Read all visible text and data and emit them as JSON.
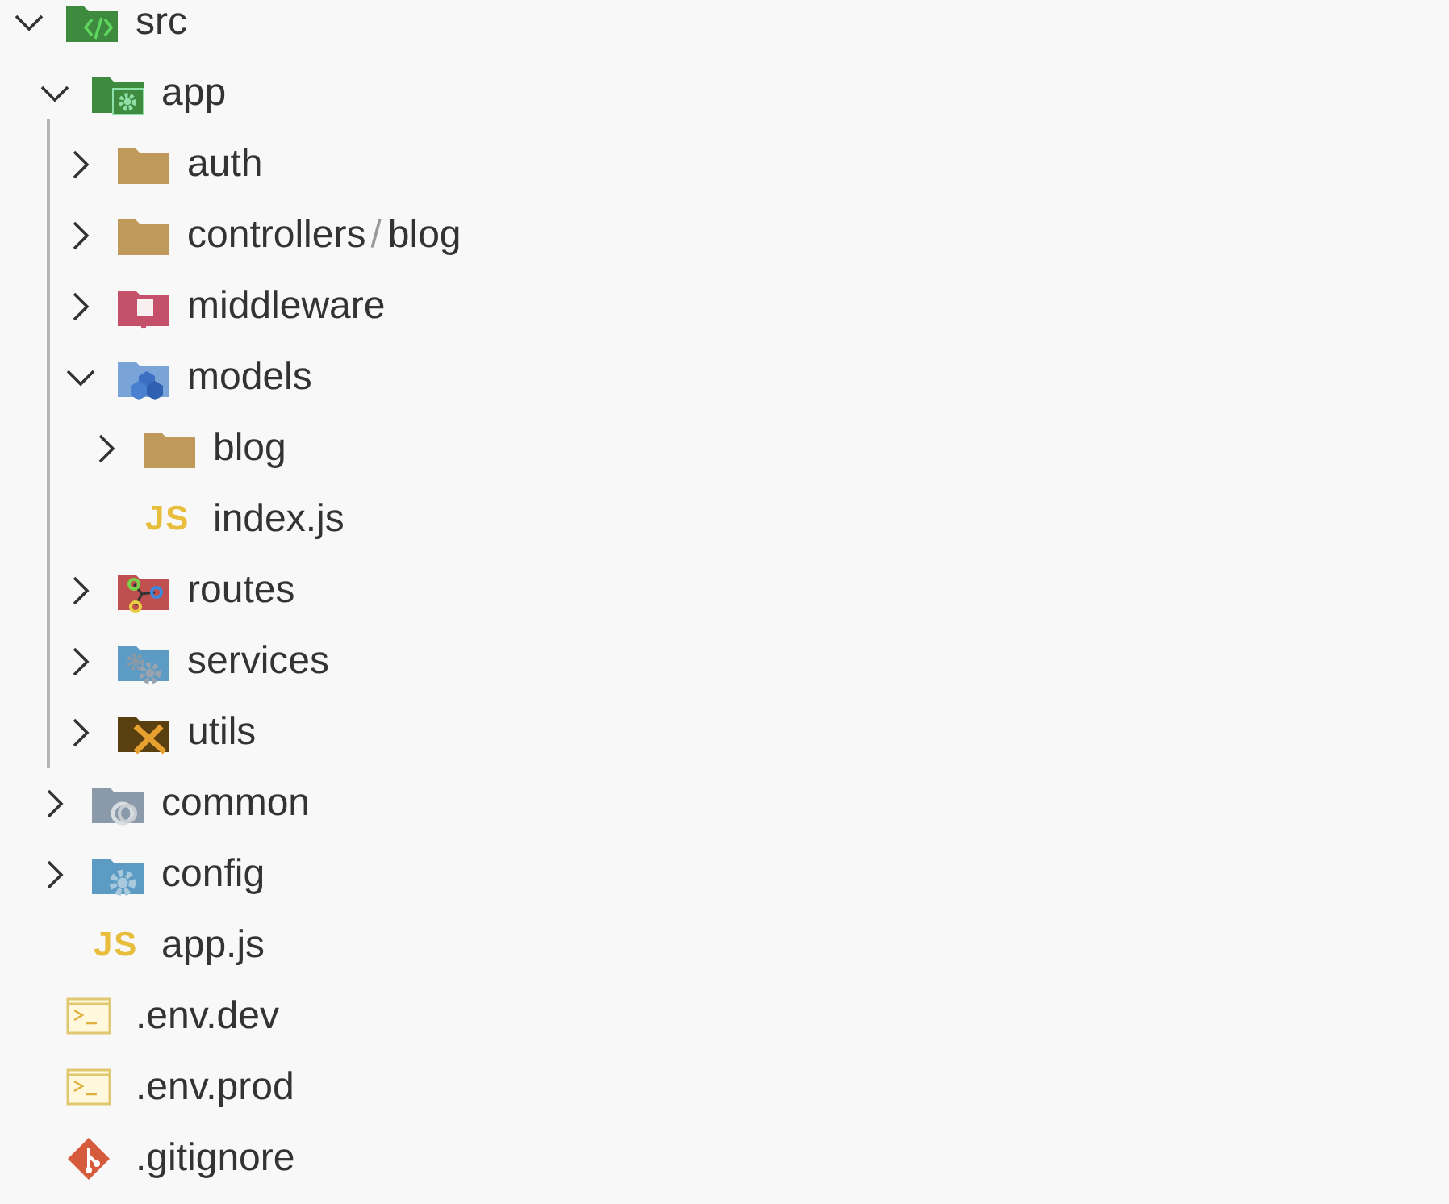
{
  "tree": [
    {
      "label": "src",
      "kind": "src",
      "expanded": true,
      "children": [
        {
          "label": "app",
          "kind": "app",
          "expanded": true,
          "guide": true,
          "children": [
            {
              "label": "auth",
              "kind": "folder",
              "expanded": false
            },
            {
              "label": "controllers",
              "separator": "/",
              "compact_label": "blog",
              "kind": "folder",
              "expanded": false
            },
            {
              "label": "middleware",
              "kind": "middleware",
              "expanded": false
            },
            {
              "label": "models",
              "kind": "models",
              "expanded": true,
              "children": [
                {
                  "label": "blog",
                  "kind": "folder",
                  "expanded": false
                },
                {
                  "label": "index.js",
                  "kind": "js",
                  "badge": "JS"
                }
              ]
            },
            {
              "label": "routes",
              "kind": "routes",
              "expanded": false
            },
            {
              "label": "services",
              "kind": "services",
              "expanded": false
            },
            {
              "label": "utils",
              "kind": "utils",
              "expanded": false
            }
          ]
        },
        {
          "label": "common",
          "kind": "common",
          "expanded": false
        },
        {
          "label": "config",
          "kind": "config",
          "expanded": false
        },
        {
          "label": "app.js",
          "kind": "js",
          "badge": "JS"
        }
      ]
    },
    {
      "label": ".env.dev",
      "kind": "terminal"
    },
    {
      "label": ".env.prod",
      "kind": "terminal"
    },
    {
      "label": ".gitignore",
      "kind": "git"
    }
  ]
}
